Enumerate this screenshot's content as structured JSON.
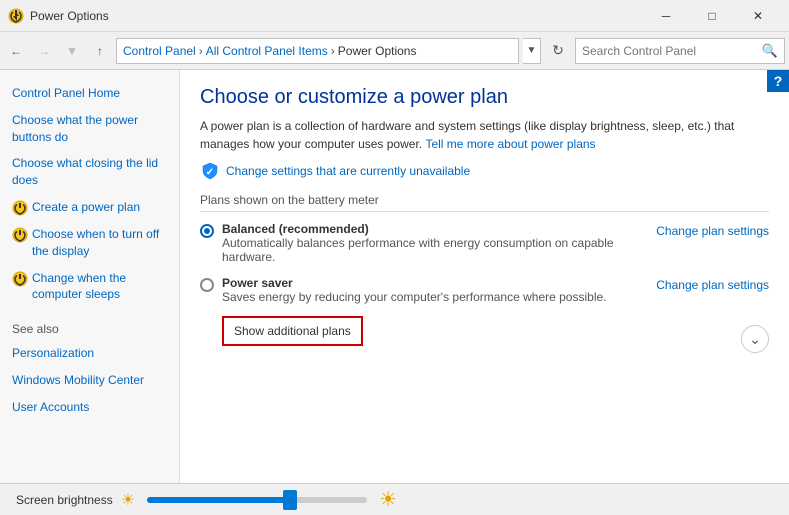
{
  "titlebar": {
    "title": "Power Options",
    "icon": "⚡",
    "min_label": "─",
    "max_label": "□",
    "close_label": "✕"
  },
  "addressbar": {
    "back_tooltip": "Back",
    "forward_tooltip": "Forward",
    "up_tooltip": "Up",
    "breadcrumb": [
      {
        "label": "Control Panel",
        "active": true
      },
      {
        "label": "All Control Panel Items",
        "active": true
      },
      {
        "label": "Power Options",
        "active": false
      }
    ],
    "search_placeholder": "Search Control Panel",
    "refresh_icon": "↻"
  },
  "sidebar": {
    "main_links": [
      {
        "label": "Control Panel Home",
        "icon": false,
        "link": true
      },
      {
        "label": "Choose what the power buttons do",
        "icon": false,
        "link": true
      },
      {
        "label": "Choose what closing the lid does",
        "icon": false,
        "link": true
      },
      {
        "label": "Create a power plan",
        "icon": true,
        "link": true
      },
      {
        "label": "Choose when to turn off the display",
        "icon": true,
        "link": true
      },
      {
        "label": "Change when the computer sleeps",
        "icon": true,
        "link": true
      }
    ],
    "see_also_label": "See also",
    "see_also_links": [
      {
        "label": "Personalization"
      },
      {
        "label": "Windows Mobility Center"
      },
      {
        "label": "User Accounts"
      }
    ]
  },
  "content": {
    "page_title": "Choose or customize a power plan",
    "description": "A power plan is a collection of hardware and system settings (like display brightness, sleep, etc.) that manages how your computer uses power.",
    "learn_more_text": "Tell me more about power plans",
    "change_unavail_text": "Change settings that are currently unavailable",
    "plans_section_label": "Plans shown on the battery meter",
    "plans": [
      {
        "name": "Balanced (recommended)",
        "desc": "Automatically balances performance with energy consumption on capable hardware.",
        "checked": true,
        "settings_link": "Change plan settings"
      },
      {
        "name": "Power saver",
        "desc": "Saves energy by reducing your computer's performance where possible.",
        "checked": false,
        "settings_link": "Change plan settings"
      }
    ],
    "show_additional_plans": "Show additional plans"
  },
  "bottom_bar": {
    "brightness_label": "Screen brightness",
    "sun_left": "☀",
    "sun_right": "☀"
  },
  "help": "?"
}
